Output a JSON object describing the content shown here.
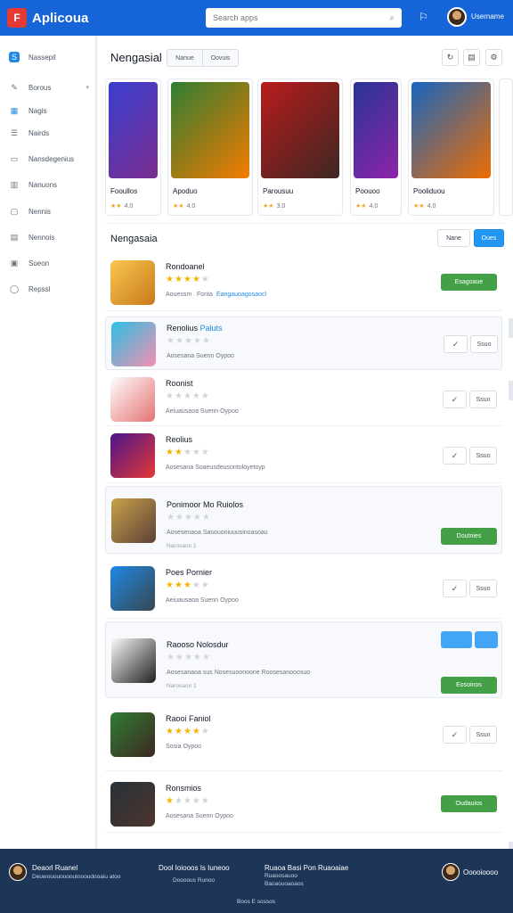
{
  "header": {
    "title": "Aplicoua",
    "logo_text": "F",
    "search_placeholder": "Search apps",
    "user_name": "Username"
  },
  "sidebar": {
    "items": [
      {
        "label": "Nassepil",
        "icon": "store-icon"
      },
      {
        "label": "Borous",
        "icon": "pen-icon"
      },
      {
        "label": "Nagis",
        "icon": "grid-icon"
      },
      {
        "label": "Nairds",
        "icon": "list-icon"
      },
      {
        "label": "Nansdegenius",
        "icon": "doc-icon"
      },
      {
        "label": "Nanuons",
        "icon": "chart-icon"
      },
      {
        "label": "Nennis",
        "icon": "note-icon"
      },
      {
        "label": "Nennois",
        "icon": "page-icon"
      },
      {
        "label": "Sueon",
        "icon": "box-icon"
      },
      {
        "label": "Repssl",
        "icon": "circle-icon"
      }
    ]
  },
  "featured": {
    "title": "Nengasial",
    "segments": [
      "Nanue",
      "Oovuis"
    ],
    "cards": [
      {
        "title": "Fooullos",
        "rating_text": "4.0",
        "stars": "★★",
        "colors": [
          "#3a3fd1",
          "#7a2c8e"
        ]
      },
      {
        "title": "Apoduo",
        "rating_text": "4.0",
        "stars": "★★",
        "colors": [
          "#2e7d32",
          "#f57c00"
        ]
      },
      {
        "title": "Parousuu",
        "rating_text": "3.0",
        "stars": "★★",
        "colors": [
          "#b71c1c",
          "#3e2723"
        ]
      },
      {
        "title": "Poouoo",
        "rating_text": "4.0",
        "stars": "★★",
        "colors": [
          "#283593",
          "#8e24aa"
        ]
      },
      {
        "title": "Pooliduou",
        "rating_text": "4.0",
        "stars": "★★",
        "colors": [
          "#1565c0",
          "#ef6c00"
        ]
      }
    ]
  },
  "list": {
    "title": "Nengasaia",
    "buttons": [
      "Nane",
      "Oues"
    ],
    "rows": [
      {
        "name": "Rondoanel",
        "name_hl": "",
        "stars": 4,
        "meta": "Aouessm . Fonta",
        "meta_link": "Eangauoagosaocl",
        "sub": "",
        "btn": "Esagoaue",
        "kind": "green-only"
      },
      {
        "name": "Renolius ",
        "name_hl": "Paluts",
        "stars": 0,
        "meta": "Aosesana  Suenn  Oypoo",
        "meta_link": "",
        "sub": "",
        "btn": "Ssuo",
        "kind": "check-act"
      },
      {
        "name": "Roonist",
        "name_hl": "",
        "stars": 0,
        "meta": "Aeiuausaoa  Suenn  Oypoo",
        "meta_link": "",
        "sub": "",
        "btn": "Ssuo",
        "kind": "check-act"
      },
      {
        "name": "Reolius",
        "name_hl": "",
        "stars": 2,
        "meta": "Aosesana  Soaeusdeusontoloyetoyp",
        "meta_link": "",
        "sub": "",
        "btn": "Ssuo",
        "kind": "check-act"
      },
      {
        "name": "Ponimoor Mo Ruiolos",
        "name_hl": "",
        "stars": 0,
        "meta": "Aosesenaoa  Sasouoniuuusinoasoau",
        "meta_link": "",
        "sub": "Narosaon 1",
        "btn": "Doutnies",
        "kind": "boxed-green"
      },
      {
        "name": "Poes Pornier",
        "name_hl": "",
        "stars": 3,
        "meta": "Aeiuausaoa  Suenn  Oypoo",
        "meta_link": "",
        "sub": "",
        "btn": "Ssuo",
        "kind": "check-act"
      },
      {
        "name": "Raooso Nolosdur",
        "name_hl": "",
        "stars": 0,
        "meta": "Aosesanaoa  sus  Nosesuoonoone  Roosesanooosuo",
        "meta_link": "",
        "sub": "Narosaon 1",
        "btn": "Eosoinos",
        "kind": "blue-green"
      },
      {
        "name": "Raooi Faniol",
        "name_hl": "",
        "stars": 4,
        "meta": "Sosia  Oypoo",
        "meta_link": "",
        "sub": "",
        "btn": "Ssuo",
        "kind": "check-act"
      },
      {
        "name": "Ronsmios",
        "name_hl": "",
        "stars": 1,
        "meta": "Aosesana  Suenn  Oypoo",
        "meta_link": "",
        "sub": "",
        "btn": "Oudauios",
        "kind": "green-only"
      }
    ]
  },
  "footer": {
    "col1_title": "Deaorl Ruanel",
    "col1_sub": "Deuwouououooutoooudooaiu atoo",
    "col2_title": "Dool Ioiooos Is Iuneoo",
    "col2_sub": "Doooous Runoo",
    "col3_title": "Ruaoa Basi Pon Ruaoaiae",
    "col3_sub1": "Ruaoosauoo",
    "col3_sub2": "Baoaouoaoaos",
    "user": "Ooooioooo",
    "bottom": "Boos E sossos"
  }
}
